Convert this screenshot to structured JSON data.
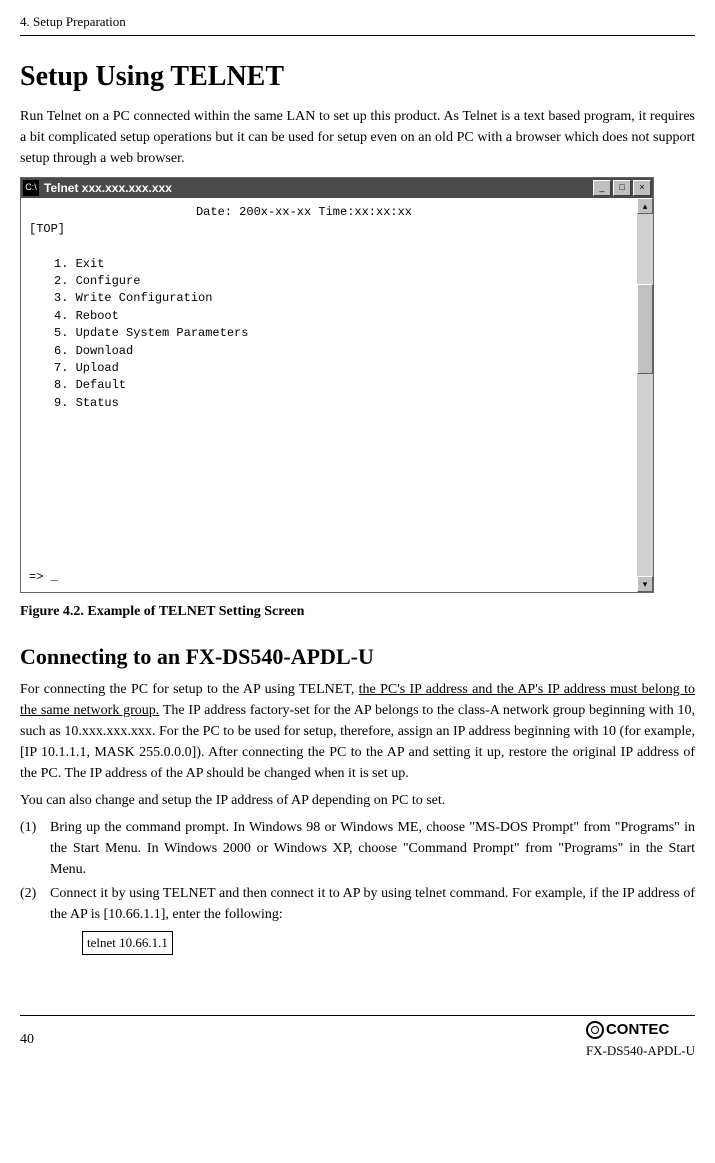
{
  "header": {
    "section": "4. Setup Preparation"
  },
  "title": "Setup Using TELNET",
  "intro": "Run Telnet on a PC connected within the same LAN to set up this product.  As Telnet is a text based program, it requires a bit complicated setup operations but it can be used for setup even on an old PC with a browser which does not support setup through a web browser.",
  "telnet_window": {
    "icon_label": "C:\\",
    "title": "Telnet xxx.xxx.xxx.xxx",
    "date_line": "Date: 200x-xx-xx  Time:xx:xx:xx",
    "top_label": "[TOP]",
    "menu": [
      "1. Exit",
      "2. Configure",
      "3. Write Configuration",
      "4. Reboot",
      "5. Update System Parameters",
      "6. Download",
      "7. Upload",
      "8. Default",
      "9. Status"
    ],
    "prompt": "=> _"
  },
  "figure_caption": "Figure 4.2.  Example of TELNET Setting Screen",
  "subheading": "Connecting to an FX-DS540-APDL-U",
  "para2_before_underline": "For connecting the PC for setup to the AP using TELNET, ",
  "para2_underline": "the PC's IP address and the AP's IP address must belong to the same network group.",
  "para2_after_underline": "  The IP address factory-set for the AP belongs to the class-A network group beginning with 10, such as 10.xxx.xxx.xxx.  For the PC to be used for setup, therefore, assign an IP address beginning with 10 (for example, [IP 10.1.1.1, MASK 255.0.0.0]).  After connecting the PC to the AP and setting it up, restore the original IP address of the PC.  The IP address of the AP should be changed when it is set up.",
  "para3": "You can also change and setup the IP address of AP depending on PC to set.",
  "steps": [
    {
      "num": "(1)",
      "text": "Bring up the command prompt.  In Windows 98 or Windows ME, choose \"MS-DOS Prompt\" from \"Programs\" in the Start Menu.  In Windows 2000 or Windows XP, choose \"Command Prompt\" from \"Programs\" in the Start Menu."
    },
    {
      "num": "(2)",
      "text": "Connect it by using TELNET and then connect it to AP by using telnet command.  For example, if the IP address of the AP is [10.66.1.1], enter the following:"
    }
  ],
  "command": "telnet 10.66.1.1",
  "footer": {
    "page": "40",
    "brand": "CONTEC",
    "model": "FX-DS540-APDL-U"
  }
}
